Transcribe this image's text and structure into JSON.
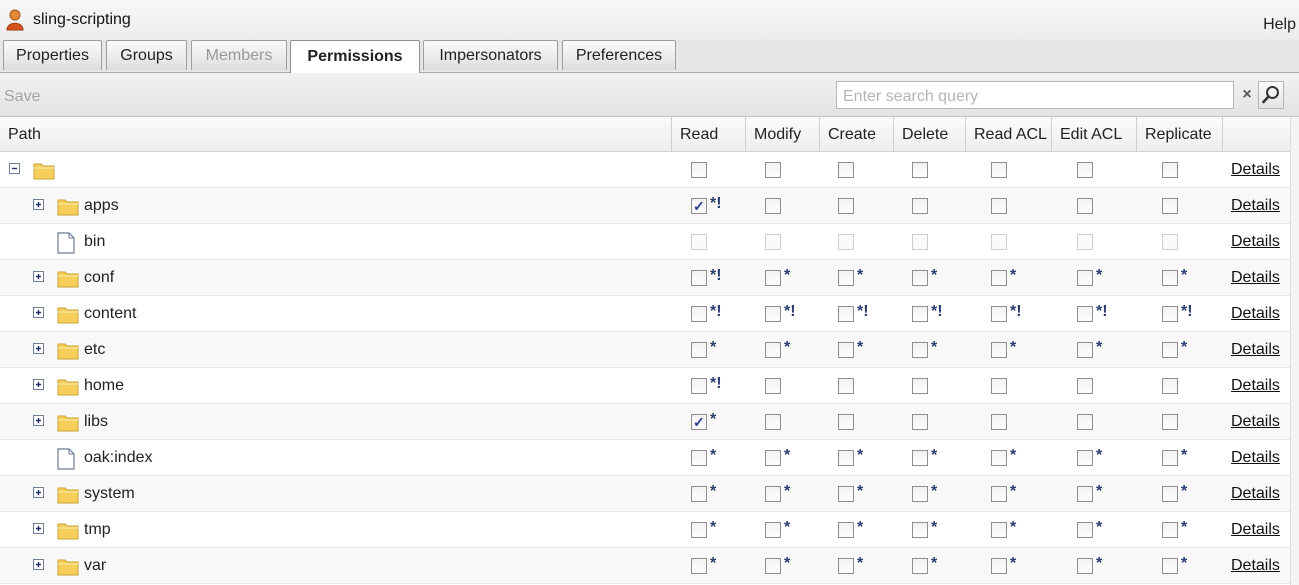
{
  "header": {
    "title": "sling-scripting",
    "help": "Help",
    "icon": "user-icon"
  },
  "tabs": [
    {
      "label": "Properties",
      "state": "normal"
    },
    {
      "label": "Groups",
      "state": "normal"
    },
    {
      "label": "Members",
      "state": "disabled"
    },
    {
      "label": "Permissions",
      "state": "active"
    },
    {
      "label": "Impersonators",
      "state": "normal"
    },
    {
      "label": "Preferences",
      "state": "normal"
    }
  ],
  "toolbar": {
    "save_label": "Save",
    "search_placeholder": "Enter search query",
    "clear_glyph": "×"
  },
  "grid": {
    "path_header": "Path",
    "permissions": [
      "Read",
      "Modify",
      "Create",
      "Delete",
      "Read ACL",
      "Edit ACL",
      "Replicate"
    ],
    "details_label": "Details",
    "rows": [
      {
        "name": "",
        "type": "folder",
        "depth": 0,
        "expander": "collapse",
        "perms": [
          {
            "c": false,
            "m": ""
          },
          {
            "c": false,
            "m": ""
          },
          {
            "c": false,
            "m": ""
          },
          {
            "c": false,
            "m": ""
          },
          {
            "c": false,
            "m": ""
          },
          {
            "c": false,
            "m": ""
          },
          {
            "c": false,
            "m": ""
          }
        ]
      },
      {
        "name": "apps",
        "type": "folder",
        "depth": 1,
        "expander": "expand",
        "perms": [
          {
            "c": true,
            "m": "*!"
          },
          {
            "c": false,
            "m": ""
          },
          {
            "c": false,
            "m": ""
          },
          {
            "c": false,
            "m": ""
          },
          {
            "c": false,
            "m": ""
          },
          {
            "c": false,
            "m": ""
          },
          {
            "c": false,
            "m": ""
          }
        ]
      },
      {
        "name": "bin",
        "type": "file",
        "depth": 1,
        "expander": "none",
        "disabled": true,
        "perms": [
          {
            "c": false,
            "m": ""
          },
          {
            "c": false,
            "m": ""
          },
          {
            "c": false,
            "m": ""
          },
          {
            "c": false,
            "m": ""
          },
          {
            "c": false,
            "m": ""
          },
          {
            "c": false,
            "m": ""
          },
          {
            "c": false,
            "m": ""
          }
        ]
      },
      {
        "name": "conf",
        "type": "folder",
        "depth": 1,
        "expander": "expand",
        "perms": [
          {
            "c": false,
            "m": "*!"
          },
          {
            "c": false,
            "m": "*"
          },
          {
            "c": false,
            "m": "*"
          },
          {
            "c": false,
            "m": "*"
          },
          {
            "c": false,
            "m": "*"
          },
          {
            "c": false,
            "m": "*"
          },
          {
            "c": false,
            "m": "*"
          }
        ]
      },
      {
        "name": "content",
        "type": "folder",
        "depth": 1,
        "expander": "expand",
        "perms": [
          {
            "c": false,
            "m": "*!"
          },
          {
            "c": false,
            "m": "*!"
          },
          {
            "c": false,
            "m": "*!"
          },
          {
            "c": false,
            "m": "*!"
          },
          {
            "c": false,
            "m": "*!"
          },
          {
            "c": false,
            "m": "*!"
          },
          {
            "c": false,
            "m": "*!"
          }
        ]
      },
      {
        "name": "etc",
        "type": "folder",
        "depth": 1,
        "expander": "expand",
        "perms": [
          {
            "c": false,
            "m": "*"
          },
          {
            "c": false,
            "m": "*"
          },
          {
            "c": false,
            "m": "*"
          },
          {
            "c": false,
            "m": "*"
          },
          {
            "c": false,
            "m": "*"
          },
          {
            "c": false,
            "m": "*"
          },
          {
            "c": false,
            "m": "*"
          }
        ]
      },
      {
        "name": "home",
        "type": "folder",
        "depth": 1,
        "expander": "expand",
        "perms": [
          {
            "c": false,
            "m": "*!"
          },
          {
            "c": false,
            "m": ""
          },
          {
            "c": false,
            "m": ""
          },
          {
            "c": false,
            "m": ""
          },
          {
            "c": false,
            "m": ""
          },
          {
            "c": false,
            "m": ""
          },
          {
            "c": false,
            "m": ""
          }
        ]
      },
      {
        "name": "libs",
        "type": "folder",
        "depth": 1,
        "expander": "expand",
        "perms": [
          {
            "c": true,
            "m": "*"
          },
          {
            "c": false,
            "m": ""
          },
          {
            "c": false,
            "m": ""
          },
          {
            "c": false,
            "m": ""
          },
          {
            "c": false,
            "m": ""
          },
          {
            "c": false,
            "m": ""
          },
          {
            "c": false,
            "m": ""
          }
        ]
      },
      {
        "name": "oak:index",
        "type": "file",
        "depth": 1,
        "expander": "none",
        "perms": [
          {
            "c": false,
            "m": "*"
          },
          {
            "c": false,
            "m": "*"
          },
          {
            "c": false,
            "m": "*"
          },
          {
            "c": false,
            "m": "*"
          },
          {
            "c": false,
            "m": "*"
          },
          {
            "c": false,
            "m": "*"
          },
          {
            "c": false,
            "m": "*"
          }
        ]
      },
      {
        "name": "system",
        "type": "folder",
        "depth": 1,
        "expander": "expand",
        "perms": [
          {
            "c": false,
            "m": "*"
          },
          {
            "c": false,
            "m": "*"
          },
          {
            "c": false,
            "m": "*"
          },
          {
            "c": false,
            "m": "*"
          },
          {
            "c": false,
            "m": "*"
          },
          {
            "c": false,
            "m": "*"
          },
          {
            "c": false,
            "m": "*"
          }
        ]
      },
      {
        "name": "tmp",
        "type": "folder",
        "depth": 1,
        "expander": "expand",
        "perms": [
          {
            "c": false,
            "m": "*"
          },
          {
            "c": false,
            "m": "*"
          },
          {
            "c": false,
            "m": "*"
          },
          {
            "c": false,
            "m": "*"
          },
          {
            "c": false,
            "m": "*"
          },
          {
            "c": false,
            "m": "*"
          },
          {
            "c": false,
            "m": "*"
          }
        ]
      },
      {
        "name": "var",
        "type": "folder",
        "depth": 1,
        "expander": "expand",
        "perms": [
          {
            "c": false,
            "m": "*"
          },
          {
            "c": false,
            "m": "*"
          },
          {
            "c": false,
            "m": "*"
          },
          {
            "c": false,
            "m": "*"
          },
          {
            "c": false,
            "m": "*"
          },
          {
            "c": false,
            "m": "*"
          },
          {
            "c": false,
            "m": "*"
          }
        ]
      }
    ]
  },
  "colors": {
    "folder": "#f5cf5a",
    "folder_edge": "#c9a232",
    "mark": "#2a3d6f",
    "check": "#2a3d8f"
  }
}
